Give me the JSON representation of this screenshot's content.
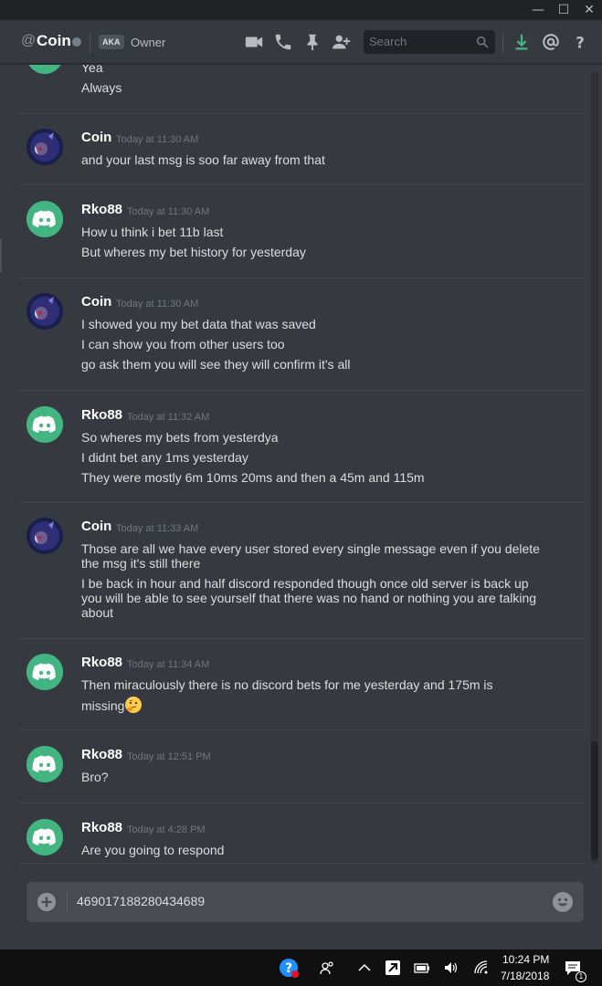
{
  "titlebar": {
    "min": "—",
    "max": "☐",
    "close": "✕"
  },
  "header": {
    "at_symbol": "@",
    "channel_name": "Coin",
    "aka_badge": "AKA",
    "nickname": "Owner",
    "search_placeholder": "Search"
  },
  "messages": [
    {
      "author": "",
      "time": "",
      "lines": [
        "Yea",
        "Always"
      ]
    },
    {
      "author": "Coin",
      "time": "Today at 11:30 AM",
      "lines": [
        "and your last msg is soo far away from that"
      ]
    },
    {
      "author": "Rko88",
      "time": "Today at 11:30 AM",
      "lines": [
        "How u think i bet 11b last",
        "But wheres my bet history for yesterday"
      ]
    },
    {
      "author": "Coin",
      "time": "Today at 11:30 AM",
      "lines": [
        "I showed you my bet data that was saved",
        "I can show you from other users too",
        "go ask them you will see they will confirm it's all"
      ]
    },
    {
      "author": "Rko88",
      "time": "Today at 11:32 AM",
      "lines": [
        "So wheres my bets from yesterdya",
        "I didnt bet any 1ms yesterday",
        "They were mostly 6m 10ms 20ms and then a 45m and  115m"
      ]
    },
    {
      "author": "Coin",
      "time": "Today at 11:33 AM",
      "lines": [
        "Those are all we have every user stored every single message even if you delete",
        "the msg it's still there",
        "I be back in hour and half discord responded though once old server is back up",
        "you will be able to see yourself that there was no hand or nothing you are talking",
        "about"
      ]
    },
    {
      "author": "Rko88",
      "time": "Today at 11:34 AM",
      "lines": [
        "Then miraculously there is no discord bets for me yesterday and 175m is",
        "missing"
      ]
    },
    {
      "author": "Rko88",
      "time": "Today at 12:51 PM",
      "lines": [
        "Bro?"
      ]
    },
    {
      "author": "Rko88",
      "time": "Today at 4:28 PM",
      "lines": [
        "Are you going to respond"
      ]
    }
  ],
  "input": {
    "value": "469017188280434689"
  },
  "taskbar": {
    "time": "10:24 PM",
    "date": "7/18/2018",
    "notification_count": "1"
  },
  "colors": {
    "accent_green": "#43b581",
    "background": "#36393f",
    "download_green": "#43b581"
  }
}
